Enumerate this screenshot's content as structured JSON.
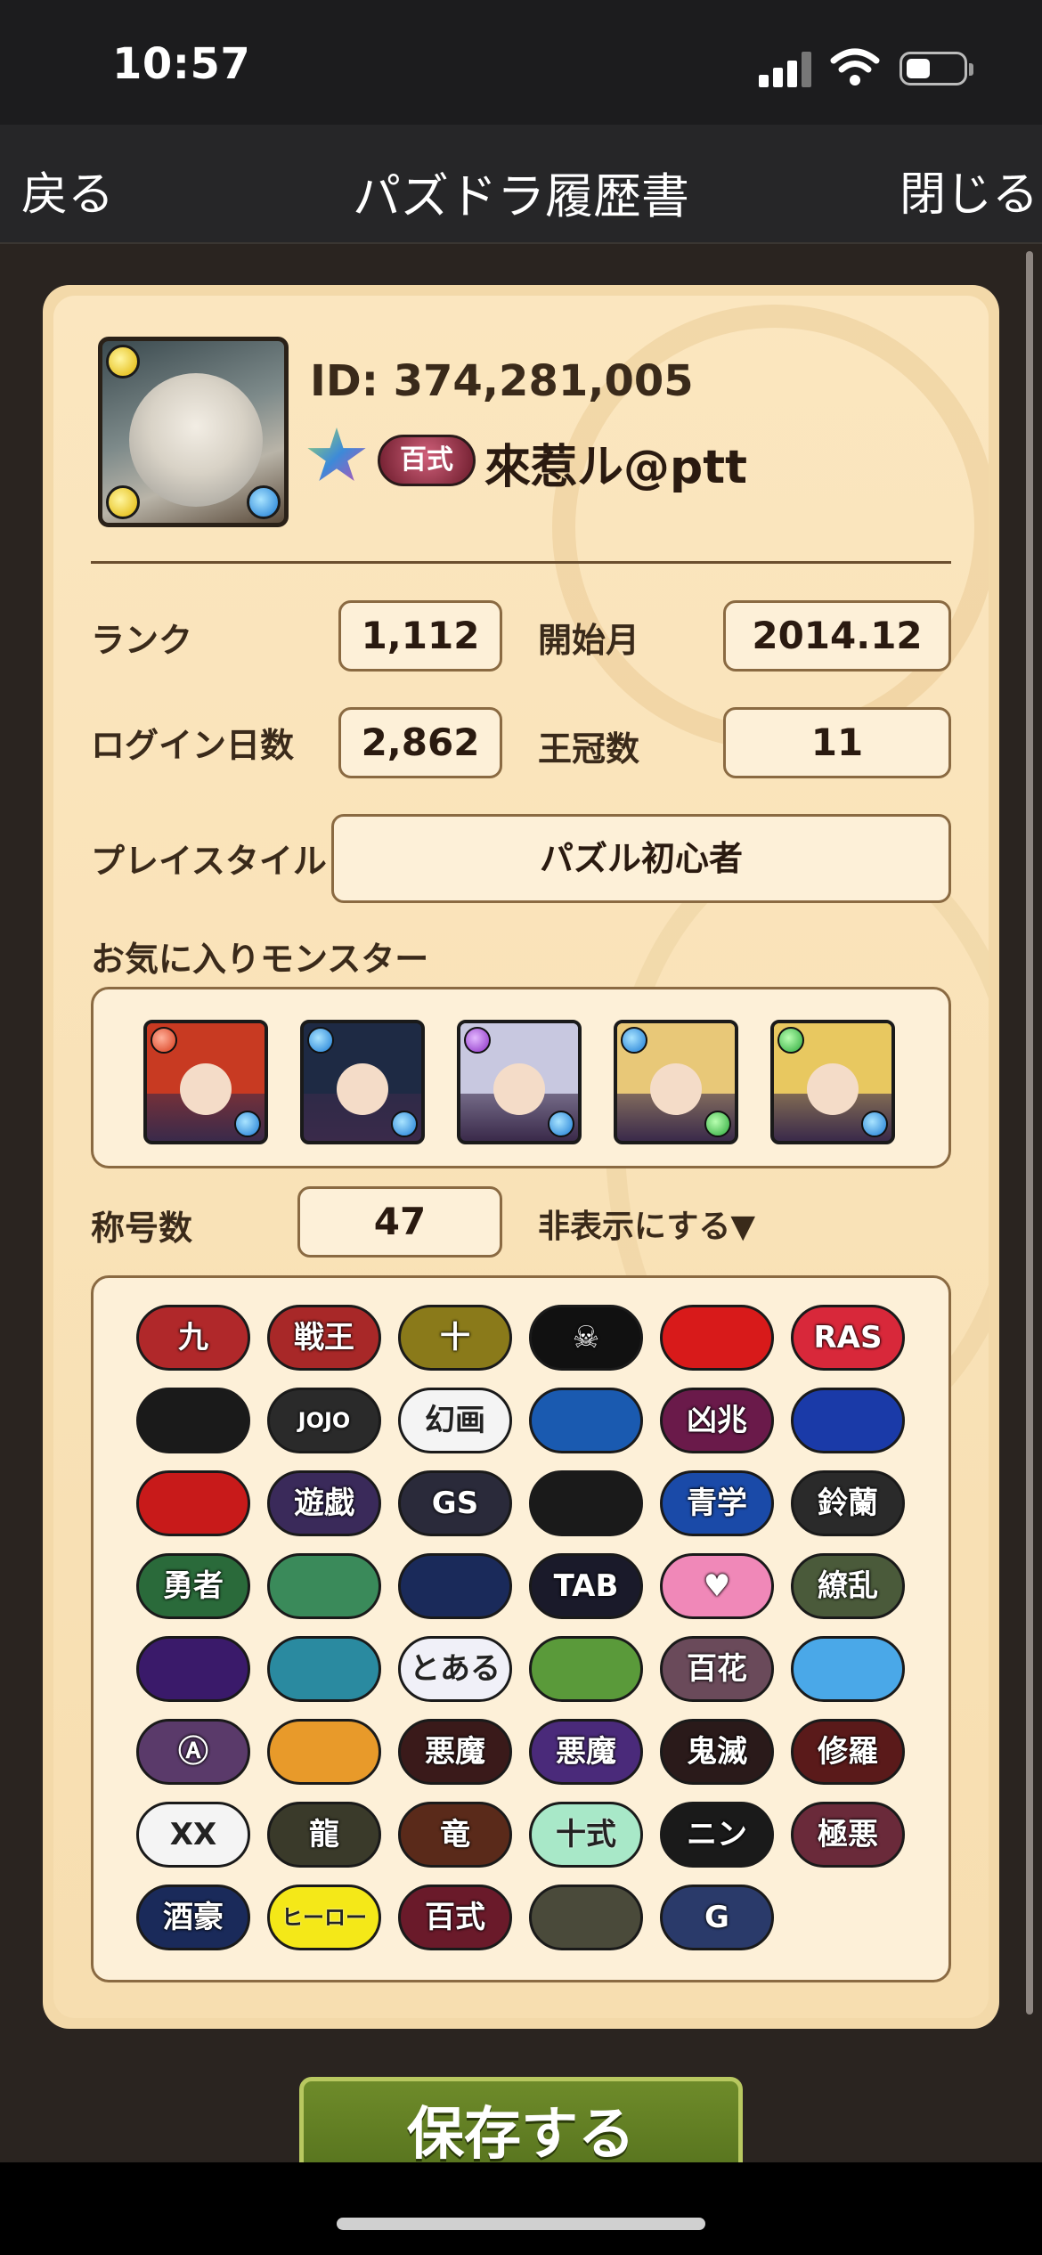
{
  "status": {
    "time": "10:57"
  },
  "nav": {
    "back": "戻る",
    "title": "パズドラ履歴書",
    "close": "閉じる"
  },
  "profile": {
    "id_text": "ID: 374,281,005",
    "title_badge": "百式",
    "name": "來惹ル@ptt"
  },
  "stats": {
    "rank_label": "ランク",
    "rank_value": "1,112",
    "start_label": "開始月",
    "start_value": "2014.12",
    "login_label": "ログイン日数",
    "login_value": "2,862",
    "crown_label": "王冠数",
    "crown_value": "11",
    "playstyle_label": "プレイスタイル",
    "playstyle_value": "パズル初心者"
  },
  "favorites": {
    "label": "お気に入りモンスター",
    "items": [
      {
        "name": "fav-monster-1",
        "hair": "#c83a22",
        "orb1": "red",
        "orb2": "blue"
      },
      {
        "name": "fav-monster-2",
        "hair": "#1e2a44",
        "orb1": "blue",
        "orb2": "blue"
      },
      {
        "name": "fav-monster-3",
        "hair": "#c8c8e0",
        "orb1": "purple",
        "orb2": "blue"
      },
      {
        "name": "fav-monster-4",
        "hair": "#e8c878",
        "orb1": "blue",
        "orb2": "green"
      },
      {
        "name": "fav-monster-5",
        "hair": "#e8c860",
        "orb1": "green",
        "orb2": "blue"
      }
    ]
  },
  "titles": {
    "count_label": "称号数",
    "count_value": "47",
    "hide_toggle": "非表示にする▼",
    "badges": [
      {
        "text": "九",
        "bg": "#b0282a"
      },
      {
        "text": "戦王",
        "bg": "#a82828"
      },
      {
        "text": "十",
        "bg": "#8a7a1a"
      },
      {
        "text": "☠",
        "bg": "#111111"
      },
      {
        "text": "",
        "bg": "#d81a1a"
      },
      {
        "text": "RAS",
        "bg": "#d8283a"
      },
      {
        "text": "",
        "bg": "#1a1a1a"
      },
      {
        "text": "JOJO",
        "bg": "#2a2a2a"
      },
      {
        "text": "幻画",
        "bg": "#f4f4f4"
      },
      {
        "text": "",
        "bg": "#1a5ab0"
      },
      {
        "text": "凶兆",
        "bg": "#6a1a4a"
      },
      {
        "text": "",
        "bg": "#1a3aa8"
      },
      {
        "text": "",
        "bg": "#c81a1a"
      },
      {
        "text": "遊戯",
        "bg": "#3a2a5a"
      },
      {
        "text": "GS",
        "bg": "#2a2a3a"
      },
      {
        "text": "",
        "bg": "#1a1a1a"
      },
      {
        "text": "青学",
        "bg": "#1a4aa8"
      },
      {
        "text": "鈴蘭",
        "bg": "#2a2a2a"
      },
      {
        "text": "勇者",
        "bg": "#2a6a3a"
      },
      {
        "text": "",
        "bg": "#3a8a5a"
      },
      {
        "text": "",
        "bg": "#1a2a5a"
      },
      {
        "text": "TAB",
        "bg": "#1a1a2a"
      },
      {
        "text": "♥",
        "bg": "#f088b8"
      },
      {
        "text": "繚乱",
        "bg": "#4a5a3a"
      },
      {
        "text": "",
        "bg": "#3a1a6a"
      },
      {
        "text": "",
        "bg": "#2a8aa0"
      },
      {
        "text": "とある",
        "bg": "#f0f0f8"
      },
      {
        "text": "",
        "bg": "#5a9a3a"
      },
      {
        "text": "百花",
        "bg": "#6a4a5a"
      },
      {
        "text": "",
        "bg": "#4aa8e8"
      },
      {
        "text": "Ⓐ",
        "bg": "#5a3a6a"
      },
      {
        "text": "",
        "bg": "#e89a2a"
      },
      {
        "text": "悪魔",
        "bg": "#3a1a1a"
      },
      {
        "text": "悪魔",
        "bg": "#4a2a7a"
      },
      {
        "text": "鬼滅",
        "bg": "#2a1a1a"
      },
      {
        "text": "修羅",
        "bg": "#5a1a1a"
      },
      {
        "text": "XX",
        "bg": "#f4f4f4"
      },
      {
        "text": "龍",
        "bg": "#3a3a2a"
      },
      {
        "text": "竜",
        "bg": "#5a2a1a"
      },
      {
        "text": "十式",
        "bg": "#a8e8c8"
      },
      {
        "text": "ニン",
        "bg": "#1a1a1a"
      },
      {
        "text": "極悪",
        "bg": "#6a2a3a"
      },
      {
        "text": "酒豪",
        "bg": "#1a2a5a"
      },
      {
        "text": "ヒーロー",
        "bg": "#f4e818"
      },
      {
        "text": "百式",
        "bg": "#6a1a2a"
      },
      {
        "text": "",
        "bg": "#4a4a3a"
      },
      {
        "text": "G",
        "bg": "#2a3a6a"
      }
    ]
  },
  "save_button": "保存する",
  "colors": {
    "panel": "#fbe6bf",
    "border": "#8a6a42",
    "save": "#5a7a20"
  }
}
